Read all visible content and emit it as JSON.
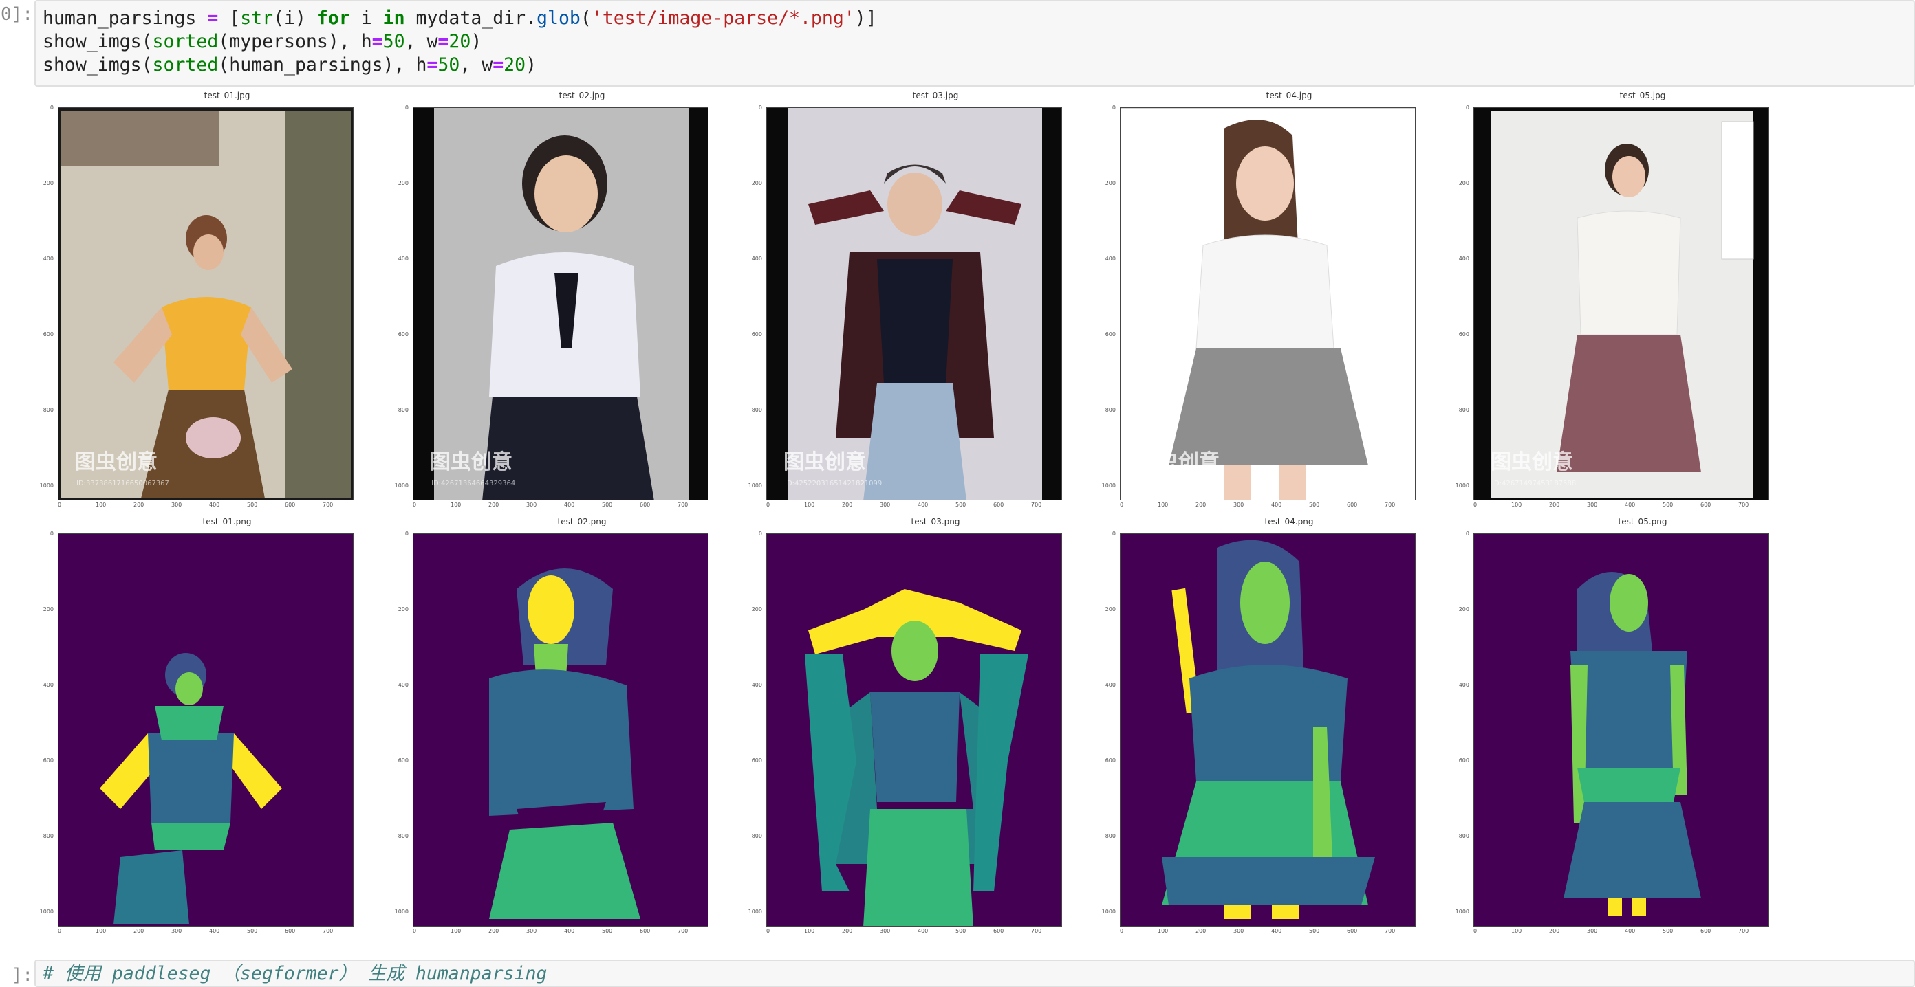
{
  "cells": [
    {
      "prompt": "0]:",
      "code_lines": [
        [
          {
            "t": "human_parsings ",
            "c": ""
          },
          {
            "t": "=",
            "c": "op"
          },
          {
            "t": " [",
            "c": ""
          },
          {
            "t": "str",
            "c": "bi"
          },
          {
            "t": "(i) ",
            "c": ""
          },
          {
            "t": "for",
            "c": "kw"
          },
          {
            "t": " i ",
            "c": ""
          },
          {
            "t": "in",
            "c": "kw"
          },
          {
            "t": " mydata_dir.",
            "c": ""
          },
          {
            "t": "glob",
            "c": "fn"
          },
          {
            "t": "(",
            "c": ""
          },
          {
            "t": "'test/image-parse/*.png'",
            "c": "st"
          },
          {
            "t": ")]",
            "c": ""
          }
        ],
        [
          {
            "t": "show_imgs(",
            "c": ""
          },
          {
            "t": "sorted",
            "c": "bi"
          },
          {
            "t": "(mypersons), h",
            "c": ""
          },
          {
            "t": "=",
            "c": "op"
          },
          {
            "t": "50",
            "c": "nm"
          },
          {
            "t": ", w",
            "c": ""
          },
          {
            "t": "=",
            "c": "op"
          },
          {
            "t": "20",
            "c": "nm"
          },
          {
            "t": ")",
            "c": ""
          }
        ],
        [
          {
            "t": "show_imgs(",
            "c": ""
          },
          {
            "t": "sorted",
            "c": "bi"
          },
          {
            "t": "(human_parsings), h",
            "c": ""
          },
          {
            "t": "=",
            "c": "op"
          },
          {
            "t": "50",
            "c": "nm"
          },
          {
            "t": ", w",
            "c": ""
          },
          {
            "t": "=",
            "c": "op"
          },
          {
            "t": "20",
            "c": "nm"
          },
          {
            "t": ")",
            "c": ""
          }
        ]
      ]
    },
    {
      "prompt": "]:",
      "comment": "# 使用 paddleseg （segformer） 生成 humanparsing"
    }
  ],
  "photos": [
    {
      "title": "test_01.jpg",
      "bg": "#c9c2b3",
      "watermark": "图虫创意",
      "wm_id": "ID:3373861716650067367"
    },
    {
      "title": "test_02.jpg",
      "bg": "#bdbdbd",
      "watermark": "图虫创意",
      "wm_id": "ID:42671364664329364"
    },
    {
      "title": "test_03.jpg",
      "bg": "#d8d6db",
      "watermark": "图虫创意",
      "wm_id": "ID:42522031651421821099"
    },
    {
      "title": "test_04.jpg",
      "bg": "#fafafa",
      "watermark": "图虫创意",
      "wm_id": ""
    },
    {
      "title": "test_05.jpg",
      "bg": "#e8e8e6",
      "watermark": "图虫创意",
      "wm_id": "ID:42671497453187588"
    }
  ],
  "parsings": [
    {
      "title": "test_01.png"
    },
    {
      "title": "test_02.png"
    },
    {
      "title": "test_03.png"
    },
    {
      "title": "test_04.png"
    },
    {
      "title": "test_05.png"
    }
  ],
  "axes": {
    "y_ticks": [
      "0",
      "200",
      "400",
      "600",
      "800",
      "1000"
    ],
    "x_ticks": [
      "0",
      "100",
      "200",
      "300",
      "400",
      "500",
      "600",
      "700"
    ]
  },
  "palette": {
    "background": "#440154",
    "hair": "#3b528b",
    "face": "#7ad151",
    "upper": "#31688e",
    "skin_arm": "#fde725",
    "lower": "#35b779",
    "coat": "#21918c",
    "legs": "#2a788e"
  }
}
